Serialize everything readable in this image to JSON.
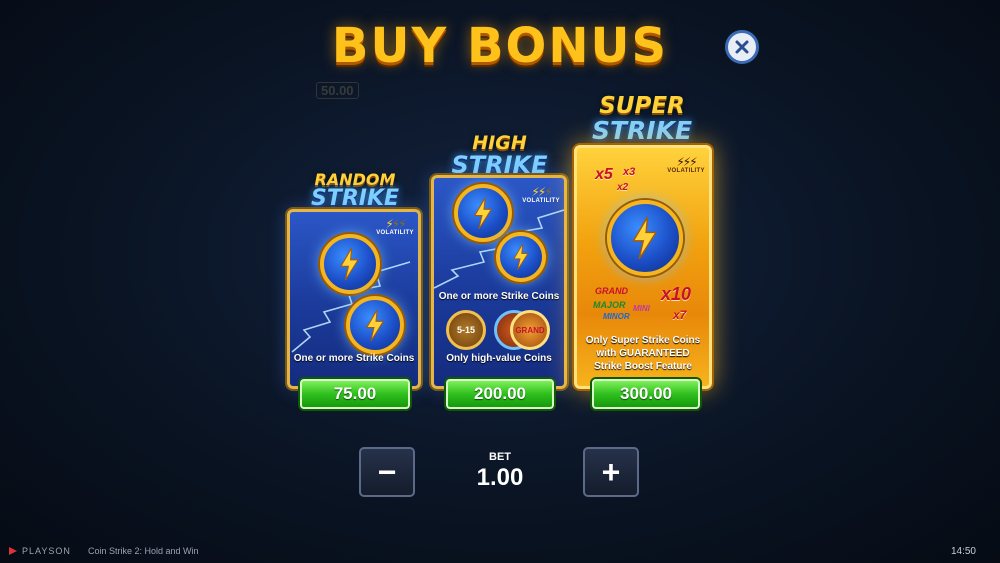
{
  "title": "BUY BONUS",
  "background": {
    "faint_value": "50.00"
  },
  "cards": [
    {
      "name_line1": "RANDOM",
      "name_line2": "STRIKE",
      "volatility_label": "VOLATILITY",
      "volatility_level": 1,
      "description": "One or more Strike Coins",
      "price": "75.00"
    },
    {
      "name_line1": "HIGH",
      "name_line2": "STRIKE",
      "volatility_label": "VOLATILITY",
      "volatility_level": 2,
      "description_top": "One or more Strike Coins",
      "coin_5_15": "5-15",
      "coin_grand": "GRAND",
      "description": "Only high-value Coins",
      "price": "200.00"
    },
    {
      "name_line1": "SUPER",
      "name_line2": "STRIKE",
      "volatility_label": "VOLATILITY",
      "volatility_level": 3,
      "multipliers": {
        "x5": "x5",
        "x3": "x3",
        "x2": "x2",
        "x10": "x10",
        "x7": "x7"
      },
      "tiers": {
        "grand": "GRAND",
        "major": "MAJOR",
        "mini": "MINI",
        "minor": "MINOR"
      },
      "description_line1": "Only Super Strike Coins",
      "description_line2": "with GUARANTEED",
      "description_line3": "Strike Boost Feature",
      "price": "300.00"
    }
  ],
  "bet": {
    "label": "BET",
    "value": "1.00",
    "minus": "−",
    "plus": "+"
  },
  "footer": {
    "brand": "PLAYSON",
    "game_title": "Coin Strike 2: Hold and Win",
    "time": "14:50"
  },
  "colors": {
    "gold": "#ffc21a",
    "blue_card": "#1b3a9a",
    "price_green": "#2fbf1e"
  }
}
